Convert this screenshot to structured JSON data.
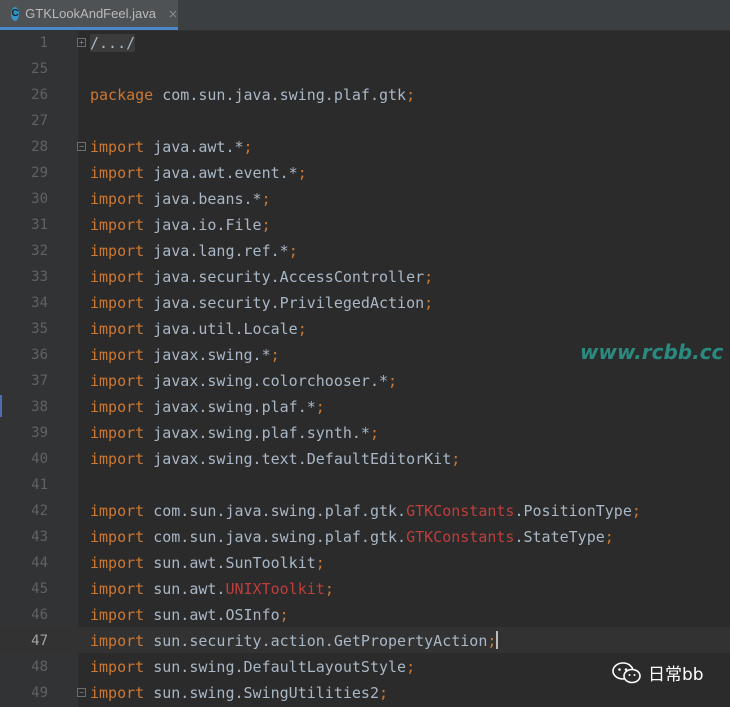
{
  "tab": {
    "icon_letter": "C",
    "title": "GTKLookAndFeel.java",
    "close": "×",
    "icon": "class-file-icon"
  },
  "editor": {
    "lines": [
      {
        "number": "1",
        "fold": "plus",
        "parts": [
          {
            "t": "/.../",
            "c": "fold-text"
          }
        ]
      },
      {
        "number": "25",
        "parts": []
      },
      {
        "number": "26",
        "parts": [
          {
            "t": "package",
            "c": "kw"
          },
          {
            "t": " com.sun.java.swing.plaf.gtk"
          },
          {
            "t": ";",
            "c": "semi"
          }
        ]
      },
      {
        "number": "27",
        "parts": []
      },
      {
        "number": "28",
        "fold": "minus",
        "parts": [
          {
            "t": "import",
            "c": "kw"
          },
          {
            "t": " java.awt.*"
          },
          {
            "t": ";",
            "c": "semi"
          }
        ]
      },
      {
        "number": "29",
        "parts": [
          {
            "t": "import",
            "c": "kw"
          },
          {
            "t": " java.awt.event.*"
          },
          {
            "t": ";",
            "c": "semi"
          }
        ]
      },
      {
        "number": "30",
        "parts": [
          {
            "t": "import",
            "c": "kw"
          },
          {
            "t": " java.beans.*"
          },
          {
            "t": ";",
            "c": "semi"
          }
        ]
      },
      {
        "number": "31",
        "parts": [
          {
            "t": "import",
            "c": "kw"
          },
          {
            "t": " java.io.File"
          },
          {
            "t": ";",
            "c": "semi"
          }
        ]
      },
      {
        "number": "32",
        "parts": [
          {
            "t": "import",
            "c": "kw"
          },
          {
            "t": " java.lang.ref.*"
          },
          {
            "t": ";",
            "c": "semi"
          }
        ]
      },
      {
        "number": "33",
        "parts": [
          {
            "t": "import",
            "c": "kw"
          },
          {
            "t": " java.security.AccessController"
          },
          {
            "t": ";",
            "c": "semi"
          }
        ]
      },
      {
        "number": "34",
        "parts": [
          {
            "t": "import",
            "c": "kw"
          },
          {
            "t": " java.security.PrivilegedAction"
          },
          {
            "t": ";",
            "c": "semi"
          }
        ]
      },
      {
        "number": "35",
        "parts": [
          {
            "t": "import",
            "c": "kw"
          },
          {
            "t": " java.util.Locale"
          },
          {
            "t": ";",
            "c": "semi"
          }
        ]
      },
      {
        "number": "36",
        "parts": [
          {
            "t": "import",
            "c": "kw"
          },
          {
            "t": " javax.swing.*"
          },
          {
            "t": ";",
            "c": "semi"
          }
        ]
      },
      {
        "number": "37",
        "parts": [
          {
            "t": "import",
            "c": "kw"
          },
          {
            "t": " javax.swing.colorchooser.*"
          },
          {
            "t": ";",
            "c": "semi"
          }
        ]
      },
      {
        "number": "38",
        "parts": [
          {
            "t": "import",
            "c": "kw"
          },
          {
            "t": " javax.swing.plaf.*"
          },
          {
            "t": ";",
            "c": "semi"
          }
        ]
      },
      {
        "number": "39",
        "parts": [
          {
            "t": "import",
            "c": "kw"
          },
          {
            "t": " javax.swing.plaf.synth.*"
          },
          {
            "t": ";",
            "c": "semi"
          }
        ]
      },
      {
        "number": "40",
        "parts": [
          {
            "t": "import",
            "c": "kw"
          },
          {
            "t": " javax.swing.text.DefaultEditorKit"
          },
          {
            "t": ";",
            "c": "semi"
          }
        ]
      },
      {
        "number": "41",
        "parts": []
      },
      {
        "number": "42",
        "parts": [
          {
            "t": "import",
            "c": "kw"
          },
          {
            "t": " com.sun.java.swing.plaf.gtk."
          },
          {
            "t": "GTKConstants",
            "c": "err"
          },
          {
            "t": ".PositionType"
          },
          {
            "t": ";",
            "c": "semi"
          }
        ]
      },
      {
        "number": "43",
        "parts": [
          {
            "t": "import",
            "c": "kw"
          },
          {
            "t": " com.sun.java.swing.plaf.gtk."
          },
          {
            "t": "GTKConstants",
            "c": "err"
          },
          {
            "t": ".StateType"
          },
          {
            "t": ";",
            "c": "semi"
          }
        ]
      },
      {
        "number": "44",
        "parts": [
          {
            "t": "import",
            "c": "kw"
          },
          {
            "t": " sun.awt.SunToolkit"
          },
          {
            "t": ";",
            "c": "semi"
          }
        ]
      },
      {
        "number": "45",
        "parts": [
          {
            "t": "import",
            "c": "kw"
          },
          {
            "t": " sun.awt."
          },
          {
            "t": "UNIXToolkit",
            "c": "err"
          },
          {
            "t": ";",
            "c": "semi"
          }
        ]
      },
      {
        "number": "46",
        "parts": [
          {
            "t": "import",
            "c": "kw"
          },
          {
            "t": " sun.awt.OSInfo"
          },
          {
            "t": ";",
            "c": "semi"
          }
        ]
      },
      {
        "number": "47",
        "current": true,
        "parts": [
          {
            "t": "import",
            "c": "kw"
          },
          {
            "t": " sun.security.action.GetPropertyAction"
          },
          {
            "t": ";",
            "c": "semi"
          },
          {
            "caret": true
          }
        ]
      },
      {
        "number": "48",
        "parts": [
          {
            "t": "import",
            "c": "kw"
          },
          {
            "t": " sun.swing.DefaultLayoutStyle"
          },
          {
            "t": ";",
            "c": "semi"
          }
        ]
      },
      {
        "number": "49",
        "fold": "minus",
        "parts": [
          {
            "t": "import",
            "c": "kw"
          },
          {
            "t": " sun.swing.SwingUtilities2"
          },
          {
            "t": ";",
            "c": "semi"
          }
        ]
      }
    ]
  },
  "watermark": "www.rcbb.cc",
  "badge": {
    "icon": "wechat-icon",
    "text": "日常bb"
  },
  "colors": {
    "background": "#2b2b2b",
    "keyword": "#cc7832",
    "identifier": "#a9b7c6",
    "error": "#bc3f3c",
    "watermark": "#2b8a7f"
  }
}
